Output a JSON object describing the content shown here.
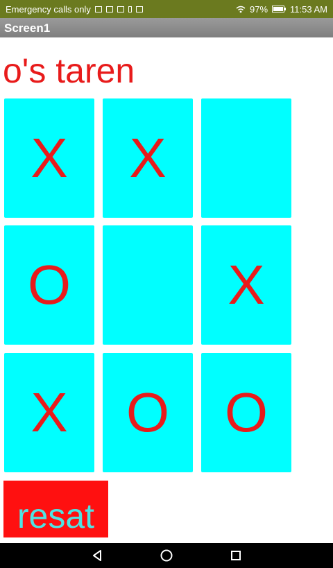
{
  "status_bar": {
    "carrier_text": "Emergency calls only",
    "battery": "97%",
    "time": "11:53 AM"
  },
  "app": {
    "title": "Screen1"
  },
  "game": {
    "turn_label": "o's taren",
    "cells": [
      "X",
      "X",
      "",
      "O",
      "",
      "X",
      "X",
      "O",
      "O"
    ],
    "reset_label": "resat"
  },
  "colors": {
    "cell_background": "#00ffff",
    "mark_color": "#e81b1b",
    "reset_background": "#ff1010",
    "reset_text": "#4fe3e3"
  },
  "icons": {
    "back": "back-triangle-icon",
    "home": "home-circle-icon",
    "recents": "recents-square-icon"
  }
}
